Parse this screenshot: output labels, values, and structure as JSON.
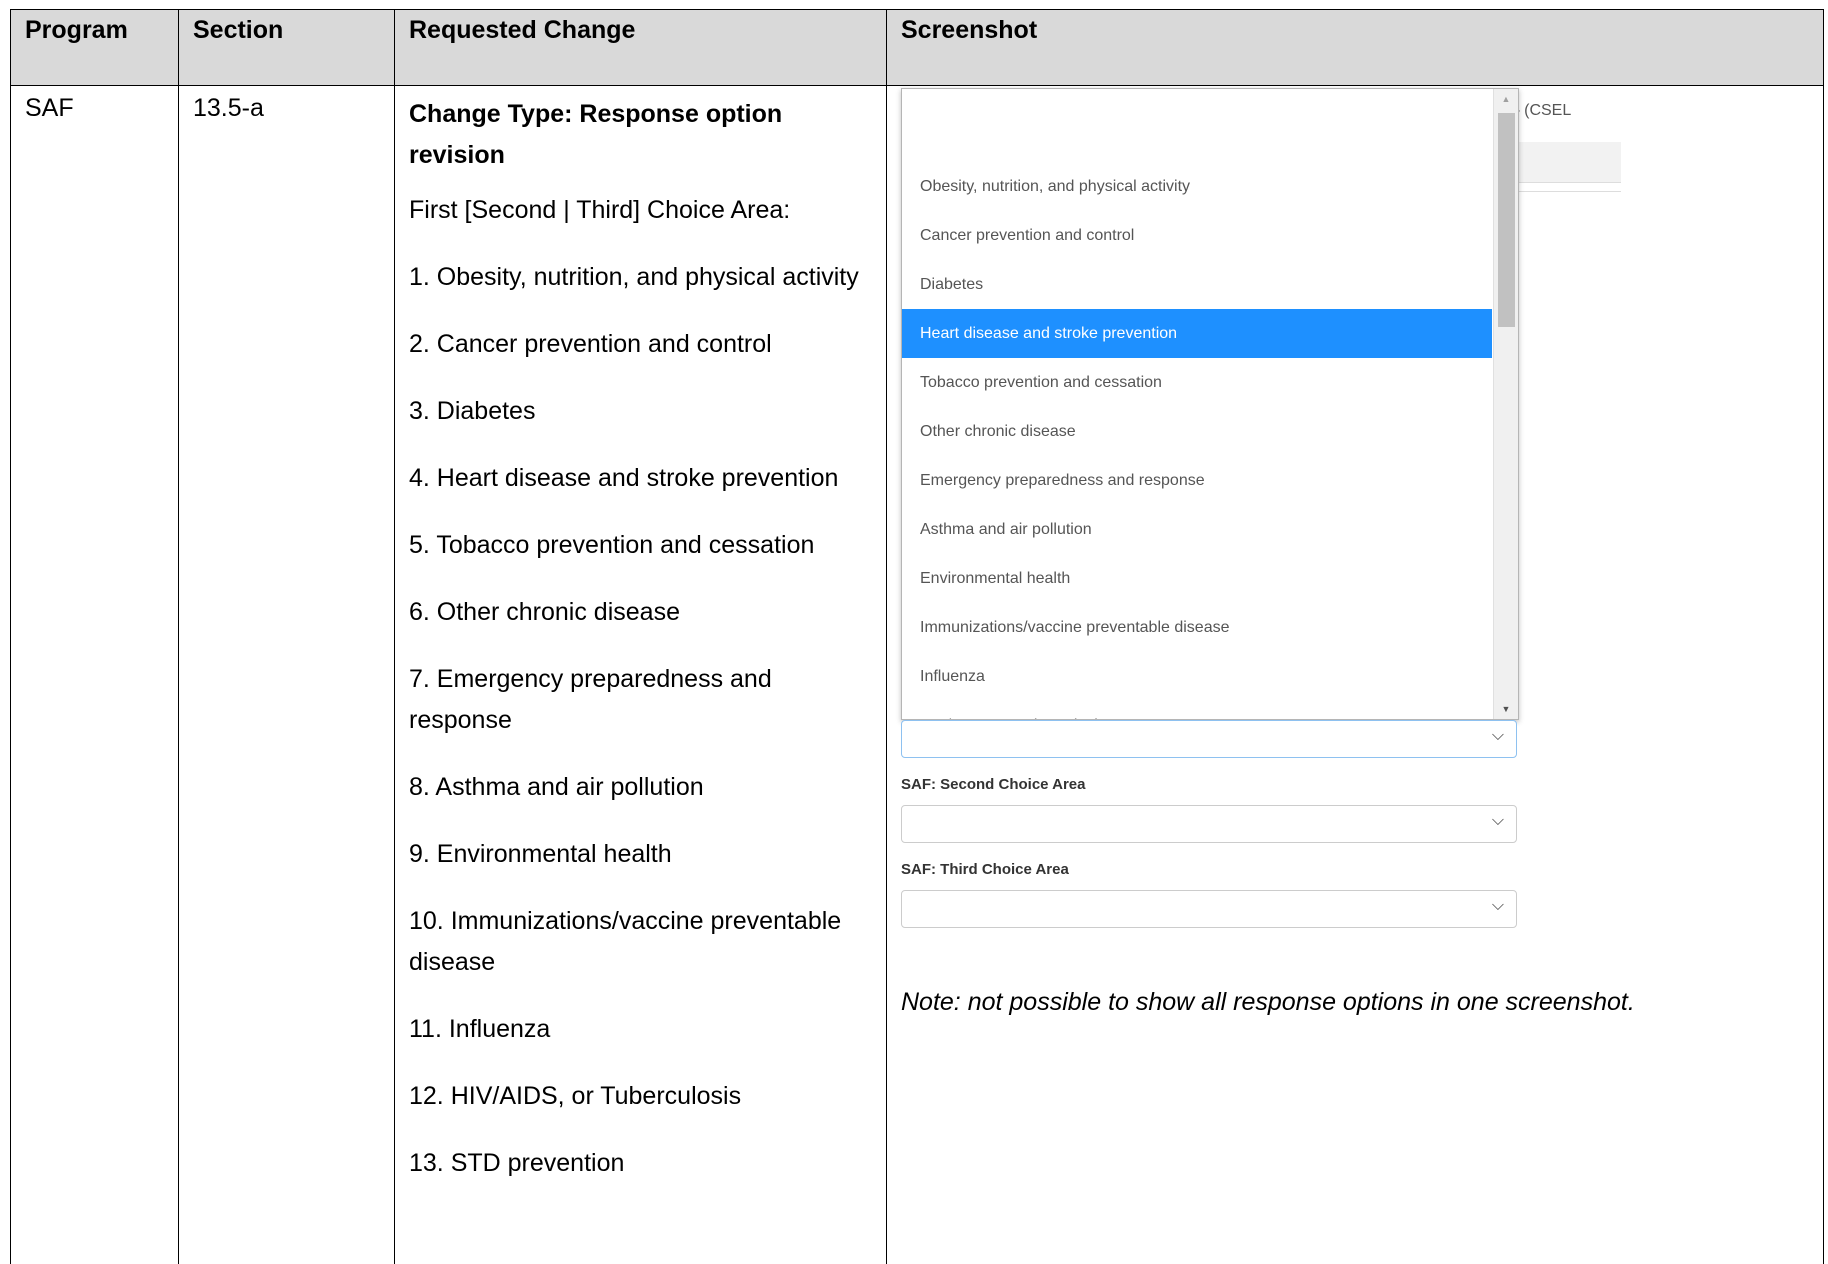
{
  "headers": {
    "program": "Program",
    "section": "Section",
    "change": "Requested Change",
    "screenshot": "Screenshot"
  },
  "row": {
    "program": "SAF",
    "section": "13.5-a",
    "change_type": "Change Type: Response option revision",
    "choice_area_line": "First [Second | Third] Choice Area:",
    "options": [
      "1. Obesity, nutrition, and physical activity",
      "2. Cancer prevention and control",
      "3. Diabetes",
      "4. Heart disease and stroke prevention",
      "5. Tobacco prevention and cessation",
      "6. Other chronic disease",
      "7. Emergency preparedness and response",
      "8. Asthma and air pollution",
      "9. Environmental health",
      "10. Immunizations/vaccine preventable disease",
      "11. Influenza",
      "12. HIV/AIDS, or Tuberculosis",
      "13. STD prevention"
    ]
  },
  "screenshot": {
    "background_fragment": ") – (CSEL",
    "listbox_items": [
      "",
      "Obesity, nutrition, and physical activity",
      "Cancer prevention and control",
      "Diabetes",
      "Heart disease and stroke prevention",
      "Tobacco prevention and cessation",
      "Other chronic disease",
      "Emergency preparedness and response",
      "Asthma and air pollution",
      "Environmental health",
      "Immunizations/vaccine preventable disease",
      "Influenza",
      "HIV/AIDS, or Tuberculosis"
    ],
    "selected_item": "Heart disease and stroke prevention",
    "second_label": "SAF: Second Choice Area",
    "third_label": "SAF: Third Choice Area",
    "chevron_icon": "chevron-down-icon",
    "accent_color": "#1e90ff",
    "note": "Note: not possible to show all response options in one screenshot."
  }
}
